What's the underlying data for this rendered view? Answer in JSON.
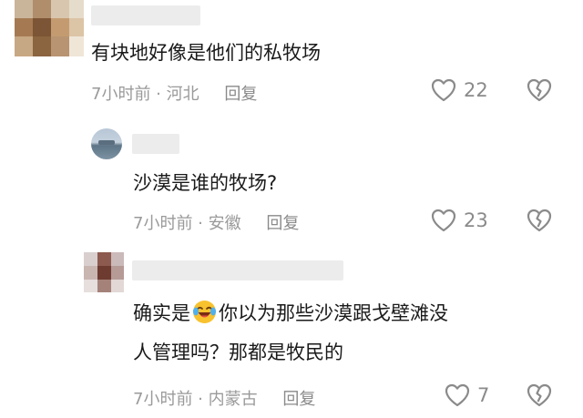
{
  "comments": [
    {
      "text_lines": [
        "有块地好像是他们的私牧场"
      ],
      "time": "7小时前",
      "location": "河北",
      "reply_label": "回复",
      "likes": "22"
    },
    {
      "text_lines": [
        "沙漠是谁的牧场?"
      ],
      "time": "7小时前",
      "location": "安徽",
      "reply_label": "回复",
      "likes": "23"
    },
    {
      "text_lines": [
        "确实是",
        "你以为那些沙漠跟戈壁滩没",
        "人管理吗？那都是牧民的"
      ],
      "emoji": "crying-laughing-emoji",
      "time": "7小时前",
      "location": "内蒙古",
      "reply_label": "回复",
      "likes": "7"
    }
  ],
  "meta_separator": " · ",
  "icons": {
    "like": "heart-outline-icon",
    "dislike": "broken-heart-icon"
  }
}
